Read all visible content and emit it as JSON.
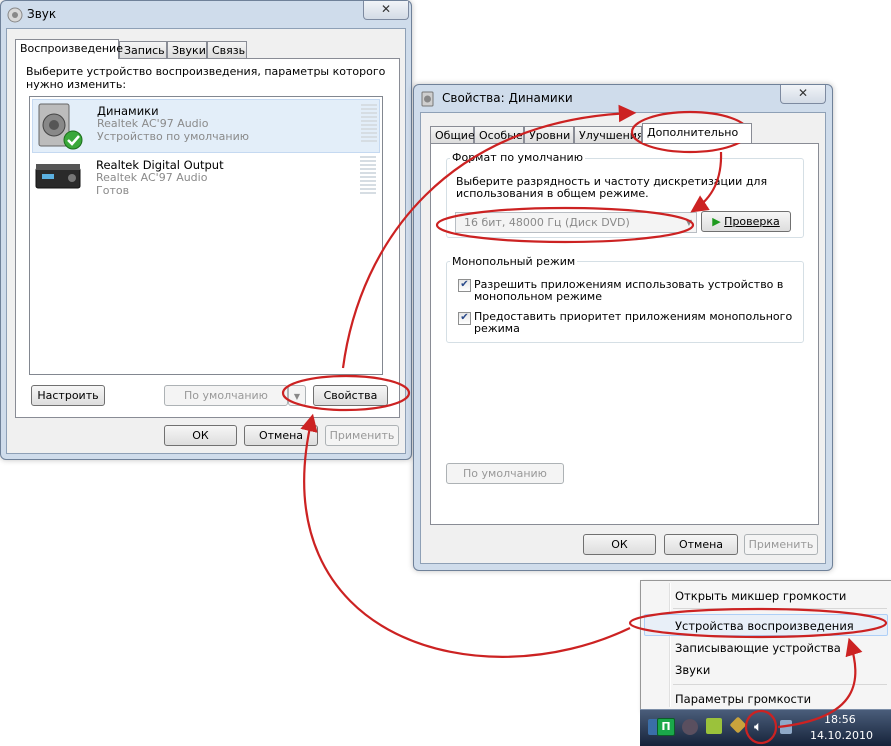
{
  "sound_dialog": {
    "title": "Звук",
    "tabs": [
      "Воспроизведение",
      "Запись",
      "Звуки",
      "Связь"
    ],
    "instruction_line1": "Выберите устройство воспроизведения, параметры которого",
    "instruction_line2": "нужно изменить:",
    "devices": [
      {
        "name": "Динамики",
        "driver": "Realtek AC'97 Audio",
        "status": "Устройство по умолчанию"
      },
      {
        "name": "Realtek Digital Output",
        "driver": "Realtek AC'97 Audio",
        "status": "Готов"
      }
    ],
    "configure_label": "Настроить",
    "default_label": "По умолчанию",
    "properties_label": "Свойства",
    "ok_label": "ОК",
    "cancel_label": "Отмена",
    "apply_label": "Применить"
  },
  "props_dialog": {
    "title": "Свойства: Динамики",
    "tabs": [
      "Общие",
      "Особые",
      "Уровни",
      "Улучшения",
      "Дополнительно"
    ],
    "format_group_label": "Формат по умолчанию",
    "format_desc_line1": "Выберите разрядность и частоту дискретизации для",
    "format_desc_line2": "использования в общем режиме.",
    "format_value": "16 бит, 48000 Гц (Диск DVD)",
    "test_label": "Проверка",
    "exclusive_group_label": "Монопольный режим",
    "exclusive_option1_line1": "Разрешить приложениям использовать устройство в",
    "exclusive_option1_line2": "монопольном режиме",
    "exclusive_option2_line1": "Предоставить приоритет приложениям монопольного",
    "exclusive_option2_line2": "режима",
    "option1_checked": true,
    "option2_checked": true,
    "restore_default_label": "По умолчанию",
    "ok_label": "ОК",
    "cancel_label": "Отмена",
    "apply_label": "Применить"
  },
  "context_menu": {
    "items": [
      "Открыть микшер громкости",
      "Устройства воспроизведения",
      "Записывающие устройства",
      "Звуки",
      "Параметры громкости"
    ]
  },
  "taskbar": {
    "time": "18:56",
    "date": "14.10.2010"
  },
  "colors": {
    "highlight_red": "#cc2222",
    "check_green": "#3aa83a",
    "test_arrow_green": "#1e9a1e",
    "selection_bg": "#e3eef9"
  }
}
